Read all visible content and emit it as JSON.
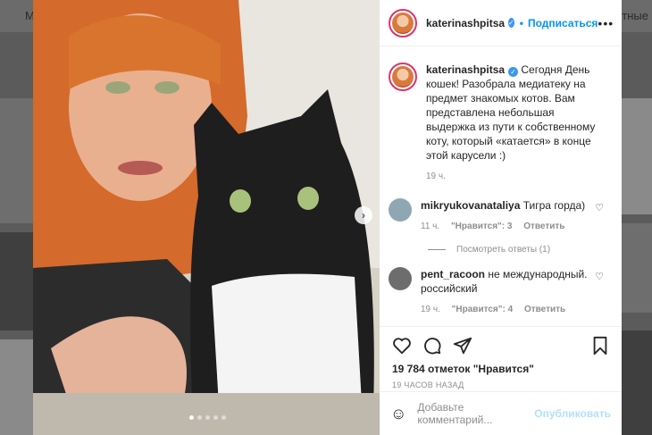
{
  "background": {
    "left_text": "М",
    "right_text": "отные"
  },
  "post": {
    "username": "katerinashpitsa",
    "follow_label": "Подписаться",
    "more_label": "•••",
    "caption": "Сегодня День кошек! Разобрала медиатеку на предмет знакомых котов. Вам представлена небольшая выдержка из пути к собственному коту, который «катается» в конце этой карусели :)",
    "caption_time": "19 ч.",
    "carousel_total": 5,
    "carousel_active": 1
  },
  "comments": [
    {
      "username": "mikryukovanataliya",
      "text": "Тигра горда)",
      "time": "11 ч.",
      "likes": "\"Нравится\": 3",
      "reply": "Ответить"
    },
    {
      "username": "pent_racoon",
      "text": "не международный. российский",
      "time": "19 ч.",
      "likes": "\"Нравится\": 4",
      "reply": "Ответить"
    }
  ],
  "view_replies": "Посмотреть ответы (1)",
  "likes_count": "19 784 отметок \"Нравится\"",
  "posted_ago": "19 ЧАСОВ НАЗАД",
  "comment_box": {
    "placeholder": "Добавьте комментарий...",
    "post_label": "Опубликовать"
  },
  "icons": {
    "like": "heart-icon",
    "comment": "comment-icon",
    "share": "share-icon",
    "save": "bookmark-icon",
    "emoji": "emoji-icon",
    "next": "chevron-right-icon"
  },
  "colors": {
    "follow": "#0095f6",
    "verified": "#3897f0",
    "muted": "#8e8e8e",
    "post_disabled": "#b2dffc"
  }
}
